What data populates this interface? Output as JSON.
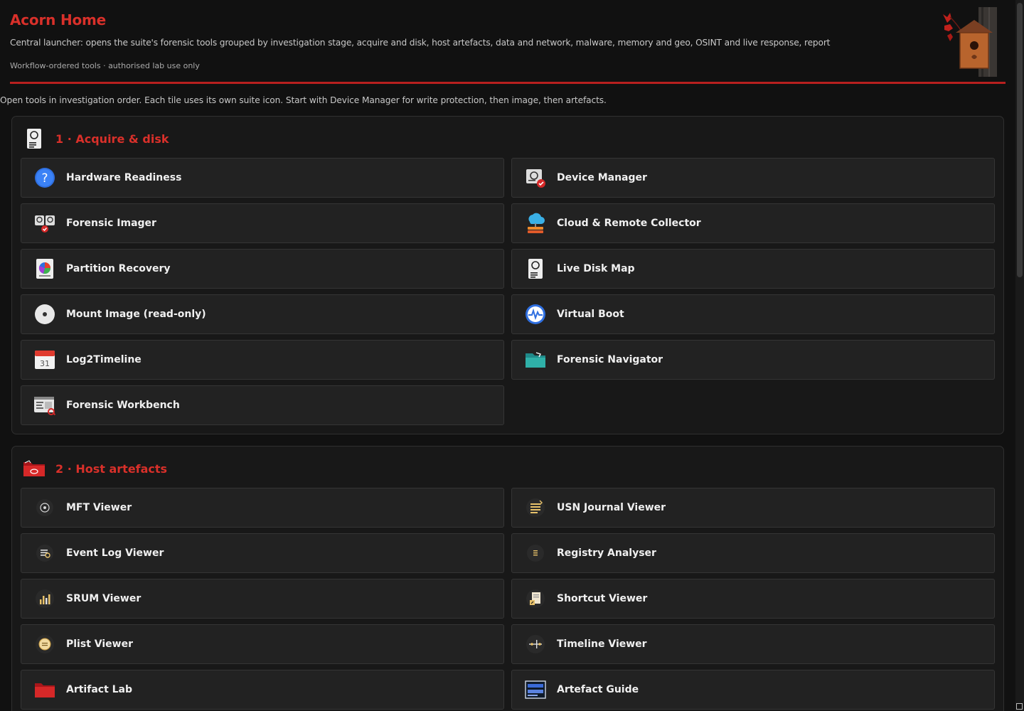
{
  "header": {
    "title": "Acorn Home",
    "subtitle": "Central launcher: opens the suite's forensic tools grouped by investigation stage, acquire and disk, host artefacts, data and network, malware, memory and geo, OSINT and live response, report",
    "tagline": "Workflow-ordered tools · authorised lab use only"
  },
  "intro": "Open tools in investigation order. Each tile uses its own suite icon. Start with Device Manager for write protection, then image, then artefacts.",
  "sections": [
    {
      "title": "1 · Acquire & disk",
      "icon": "drive-icon",
      "tiles": [
        {
          "label": "Hardware Readiness",
          "icon": "question-icon"
        },
        {
          "label": "Device Manager",
          "icon": "device-shield-icon"
        },
        {
          "label": "Forensic Imager",
          "icon": "imager-icon"
        },
        {
          "label": "Cloud & Remote Collector",
          "icon": "cloud-icon"
        },
        {
          "label": "Partition Recovery",
          "icon": "partition-icon"
        },
        {
          "label": "Live Disk Map",
          "icon": "drive-icon"
        },
        {
          "label": "Mount Image (read-only)",
          "icon": "disc-icon"
        },
        {
          "label": "Virtual Boot",
          "icon": "pulse-icon"
        },
        {
          "label": "Log2Timeline",
          "icon": "calendar-icon"
        },
        {
          "label": "Forensic Navigator",
          "icon": "folder-icon"
        },
        {
          "label": "Forensic Workbench",
          "icon": "workbench-icon"
        }
      ]
    },
    {
      "title": "2 · Host artefacts",
      "icon": "red-folder-icon",
      "tiles": [
        {
          "label": "MFT Viewer",
          "icon": "mft-icon"
        },
        {
          "label": "USN Journal Viewer",
          "icon": "journal-icon"
        },
        {
          "label": "Event Log Viewer",
          "icon": "event-log-icon"
        },
        {
          "label": "Registry Analyser",
          "icon": "registry-icon"
        },
        {
          "label": "SRUM Viewer",
          "icon": "bar-chart-icon"
        },
        {
          "label": "Shortcut Viewer",
          "icon": "shortcut-icon"
        },
        {
          "label": "Plist Viewer",
          "icon": "plist-icon"
        },
        {
          "label": "Timeline Viewer",
          "icon": "timeline-icon"
        },
        {
          "label": "Artifact Lab",
          "icon": "red-folder-icon"
        },
        {
          "label": "Artefact Guide",
          "icon": "guide-icon"
        }
      ]
    }
  ],
  "colors": {
    "accent": "#d9302a",
    "background": "#111111",
    "tile": "#222222"
  }
}
